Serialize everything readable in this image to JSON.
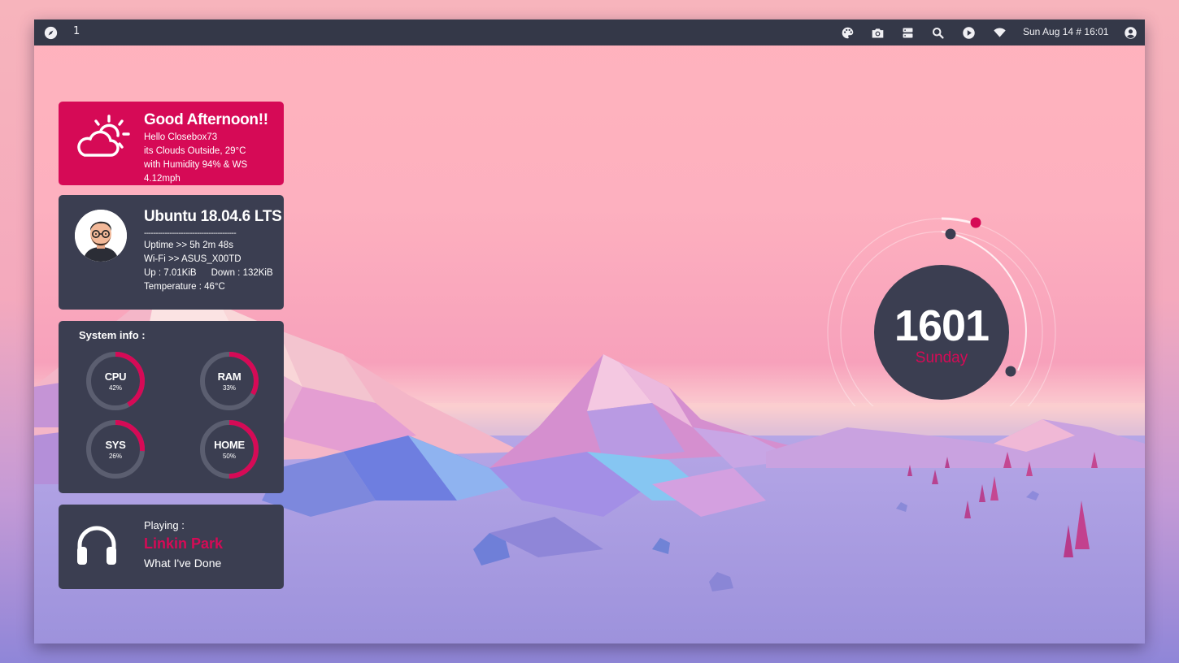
{
  "topbar": {
    "workspace": "1",
    "datetime": "Sun Aug 14 # 16:01",
    "icons": [
      "compass-icon",
      "palette-icon",
      "camera-icon",
      "server-icon",
      "search-icon",
      "play-icon",
      "wifi-icon",
      "user-icon"
    ]
  },
  "weather": {
    "title": "Good Afternoon!!",
    "greeting": "Hello Closebox73",
    "condition": "its Clouds Outside, 29°C",
    "details": "with Humidity 94% & WS 4.12mph",
    "icon": "partly-cloudy-icon"
  },
  "system": {
    "os": "Ubuntu 18.04.6 LTS",
    "separator": "----------------------------------------",
    "uptime": "Uptime >> 5h 2m 48s",
    "wifi": "Wi-Fi >> ASUS_X00TD",
    "up": "Up : 7.01KiB",
    "down": "Down : 132KiB",
    "temperature": "Temperature : 46°C"
  },
  "sysinfo": {
    "title": "System info :",
    "gauges": [
      {
        "name": "CPU",
        "label": "42%",
        "value": 42
      },
      {
        "name": "RAM",
        "label": "33%",
        "value": 33
      },
      {
        "name": "SYS",
        "label": "26%",
        "value": 26
      },
      {
        "name": "HOME",
        "label": "50%",
        "value": 50
      }
    ]
  },
  "music": {
    "label": "Playing :",
    "artist": "Linkin Park",
    "track": "What I've Done",
    "icon": "headphones-icon"
  },
  "clock": {
    "time": "1601",
    "day": "Sunday"
  },
  "colors": {
    "accent": "#d60a56",
    "panel": "#3b3e51",
    "topbar": "#343848",
    "track": "#5b5e70"
  }
}
